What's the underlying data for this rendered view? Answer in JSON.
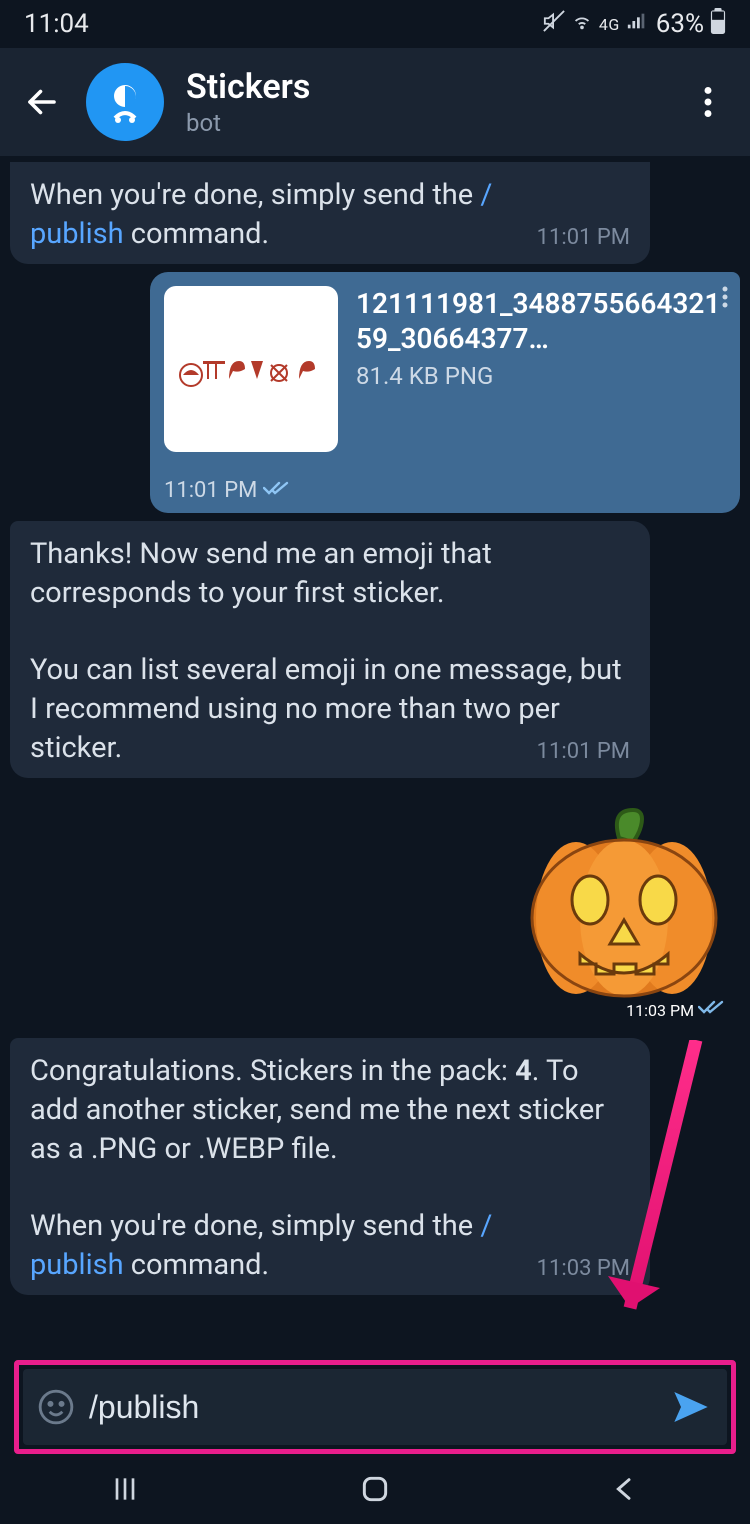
{
  "status": {
    "time": "11:04",
    "network_label": "4G",
    "battery_pct": "63%"
  },
  "header": {
    "title": "Stickers",
    "subtitle": "bot"
  },
  "messages": {
    "m1": {
      "text_a": "When you're done, simply send the ",
      "cmd_slash": "/",
      "cmd_text": "publish",
      "text_b": " command.",
      "time": "11:01 PM"
    },
    "m2": {
      "file_name": "121111981_348875566432159_30664377…",
      "file_size": "81.4 KB PNG",
      "time": "11:01 PM"
    },
    "m3": {
      "para1": "Thanks! Now send me an emoji that corresponds to your first sticker.",
      "para2": "You can list several emoji in one message, but I recommend using no more than two per sticker.",
      "time": "11:01 PM"
    },
    "m4": {
      "time": "11:03 PM"
    },
    "m5": {
      "text_a": "Congratulations. Stickers in the pack: ",
      "count": "4",
      "text_b": ". To add another sticker, send me the next sticker as a .PNG or .WEBP file.",
      "text_c": "When you're done, simply send the ",
      "cmd_slash": "/",
      "cmd_text": "publish",
      "text_d": " command.",
      "time": "11:03 PM"
    }
  },
  "input": {
    "value": "/publish"
  }
}
